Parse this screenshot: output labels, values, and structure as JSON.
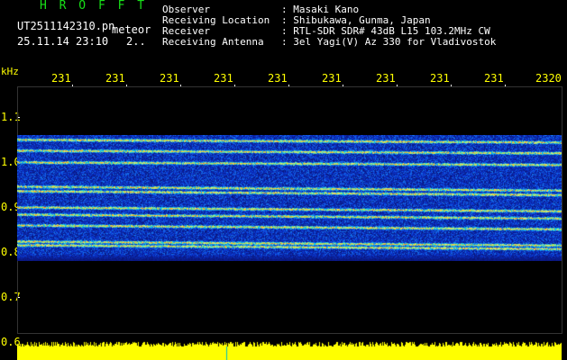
{
  "header": {
    "logo_text": "H R O F F T",
    "filename": "UT2511142310.pn",
    "meteor_label": "meteor",
    "datetime": "25.11.14 23:10",
    "count": "2.."
  },
  "info": {
    "rows": [
      {
        "label": "Observer",
        "value": ": Masaki Kano"
      },
      {
        "label": "Receiving Location",
        "value": ": Shibukawa, Gunma, Japan"
      },
      {
        "label": "Receiver",
        "value": ": RTL-SDR SDR# 43dB L15 103.2MHz CW"
      },
      {
        "label": "Receiving Antenna",
        "value": ": 3el Yagi(V) Az 330 for Vladivostok"
      }
    ]
  },
  "axis": {
    "unit": "kHz",
    "y_ticks": [
      "1.1",
      "1.0",
      "0.9",
      "0.8",
      "0.7",
      "0.6"
    ],
    "x_ticks": [
      "231",
      "231",
      "231",
      "231",
      "231",
      "231",
      "231",
      "231",
      "231",
      "2320"
    ]
  },
  "colors": {
    "background": "#000000",
    "axis_text": "#ffff00",
    "header_green": "#18e018",
    "spectro_low": "#0a1e8c",
    "spectro_mid": "#22aaff",
    "spectro_high": "#ffff40",
    "spectro_peak": "#ff2020",
    "baseline": "#ffff00"
  }
}
